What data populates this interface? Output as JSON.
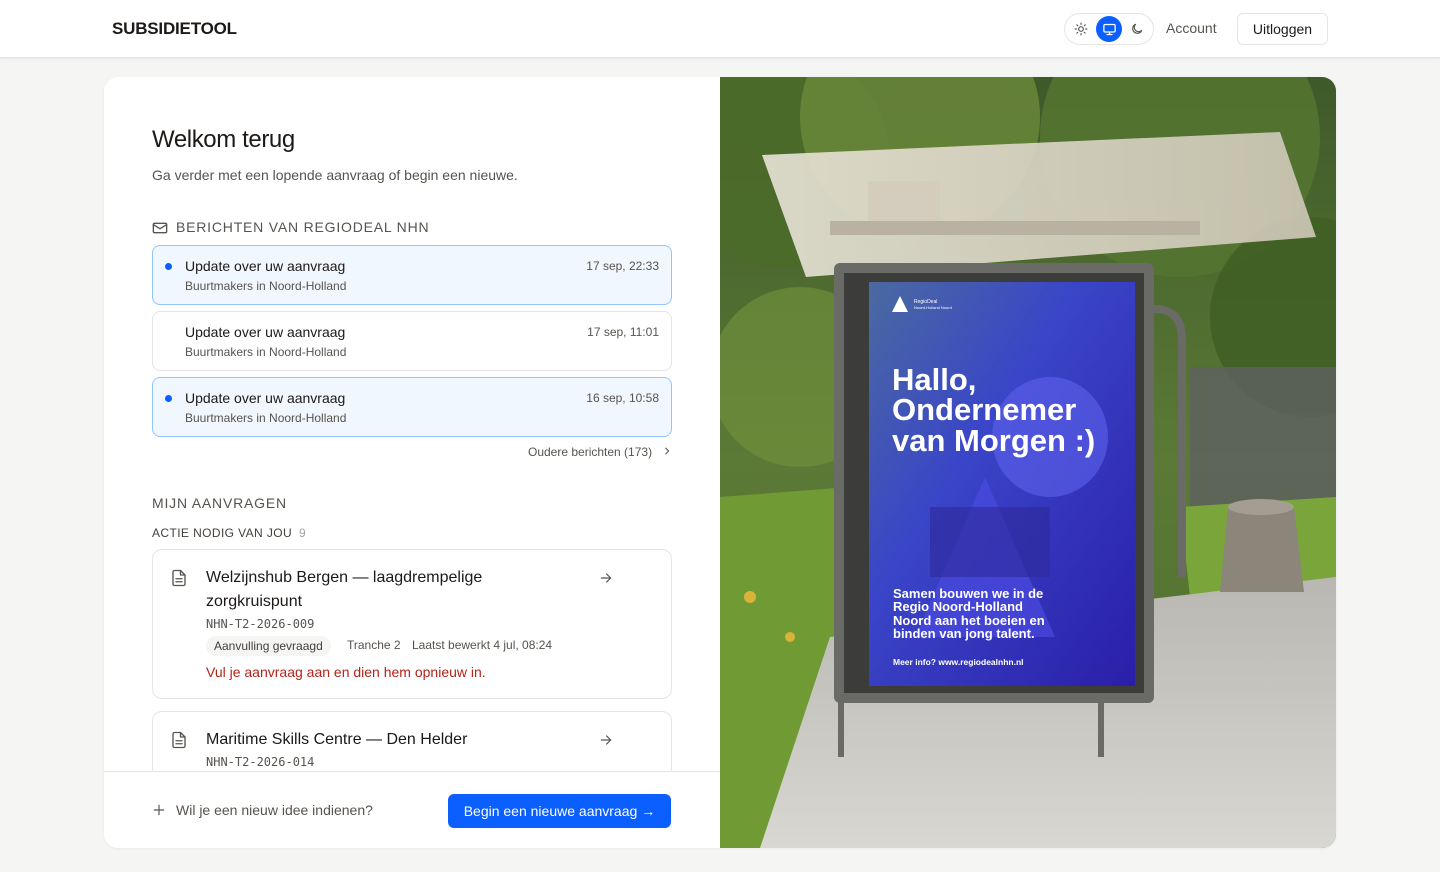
{
  "header": {
    "brand": "SUBSIDIETOOL",
    "account": "Account",
    "logout": "Uitloggen",
    "theme_options": [
      "sun-icon",
      "monitor-icon",
      "moon-icon"
    ],
    "accent_color": "#0b5fff"
  },
  "welcome": {
    "title": "Welkom terug",
    "subtitle": "Ga verder met een lopende aanvraag of begin een nieuwe."
  },
  "messages": {
    "heading": "Berichten van Regiodeal NHN",
    "items": [
      {
        "title": "Update over uw aanvraag",
        "subtitle": "Buurtmakers in Noord-Holland",
        "time": "17 sep, 22:33",
        "unread": true
      },
      {
        "title": "Update over uw aanvraag",
        "subtitle": "Buurtmakers in Noord-Holland",
        "time": "17 sep, 11:01",
        "unread": false
      },
      {
        "title": "Update over uw aanvraag",
        "subtitle": "Buurtmakers in Noord-Holland",
        "time": "16 sep, 10:58",
        "unread": true
      }
    ],
    "older_link": "Oudere berichten (173)"
  },
  "applications": {
    "heading": "Mijn aanvragen",
    "action_heading": "Actie nodig van jou",
    "action_count": "9",
    "items": [
      {
        "title": "Welzijnshub Bergen — laagdrempelige zorgkruispunt",
        "code": "NHN-T2-2026-009",
        "badge": "Aanvulling gevraagd",
        "tranche": "Tranche 2",
        "last_edited": "Laatst bewerkt 4 jul, 08:24",
        "warning": "Vul je aanvraag aan en dien hem opnieuw in."
      },
      {
        "title": "Maritime Skills Centre — Den Helder",
        "code": "NHN-T2-2026-014"
      }
    ]
  },
  "footer": {
    "idea_prompt": "Wil je een nieuw idee indienen?",
    "new_button": "Begin een nieuwe aanvraag",
    "new_button_arrow": "→"
  },
  "poster": {
    "logo_name": "RegioDeal",
    "logo_sub": "Noord-Holland Noord",
    "headline": [
      "Hallo,",
      "Ondernemer",
      "van Morgen :)"
    ],
    "body": [
      "Samen bouwen we in de",
      "Regio Noord-Holland",
      "Noord aan het boeien en",
      "binden van jong talent."
    ],
    "url": "Meer info? www.regiodealnhn.nl"
  }
}
